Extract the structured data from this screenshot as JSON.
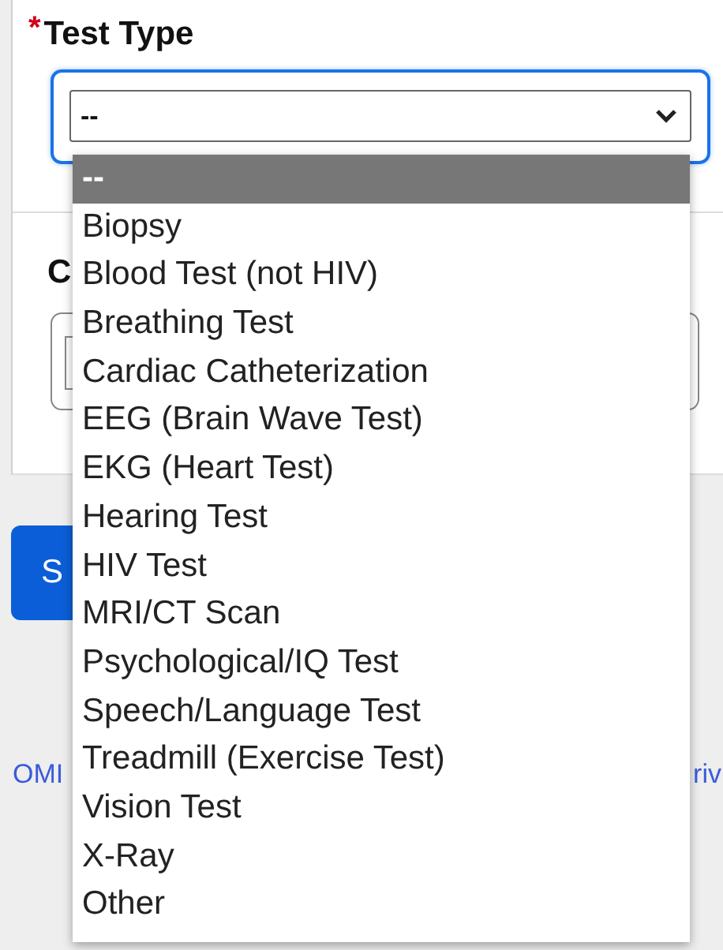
{
  "test_type": {
    "label": "Test Type",
    "required": true,
    "required_mark": "*",
    "value": "--"
  },
  "dropdown": {
    "options": [
      {
        "label": "--",
        "selected": true
      },
      {
        "label": "Biopsy",
        "selected": false
      },
      {
        "label": "Blood Test (not HIV)",
        "selected": false
      },
      {
        "label": "Breathing Test",
        "selected": false
      },
      {
        "label": "Cardiac Catheterization",
        "selected": false
      },
      {
        "label": "EEG (Brain Wave Test)",
        "selected": false
      },
      {
        "label": "EKG (Heart Test)",
        "selected": false
      },
      {
        "label": "Hearing Test",
        "selected": false
      },
      {
        "label": "HIV Test",
        "selected": false
      },
      {
        "label": "MRI/CT Scan",
        "selected": false
      },
      {
        "label": "Psychological/IQ Test",
        "selected": false
      },
      {
        "label": "Speech/Language Test",
        "selected": false
      },
      {
        "label": "Treadmill (Exercise Test)",
        "selected": false
      },
      {
        "label": "Vision Test",
        "selected": false
      },
      {
        "label": "X-Ray",
        "selected": false
      },
      {
        "label": "Other",
        "selected": false
      }
    ]
  },
  "second_field": {
    "label": "C"
  },
  "submit_button": {
    "label": "S"
  },
  "footer_links": [
    "OMI",
    "riv"
  ]
}
